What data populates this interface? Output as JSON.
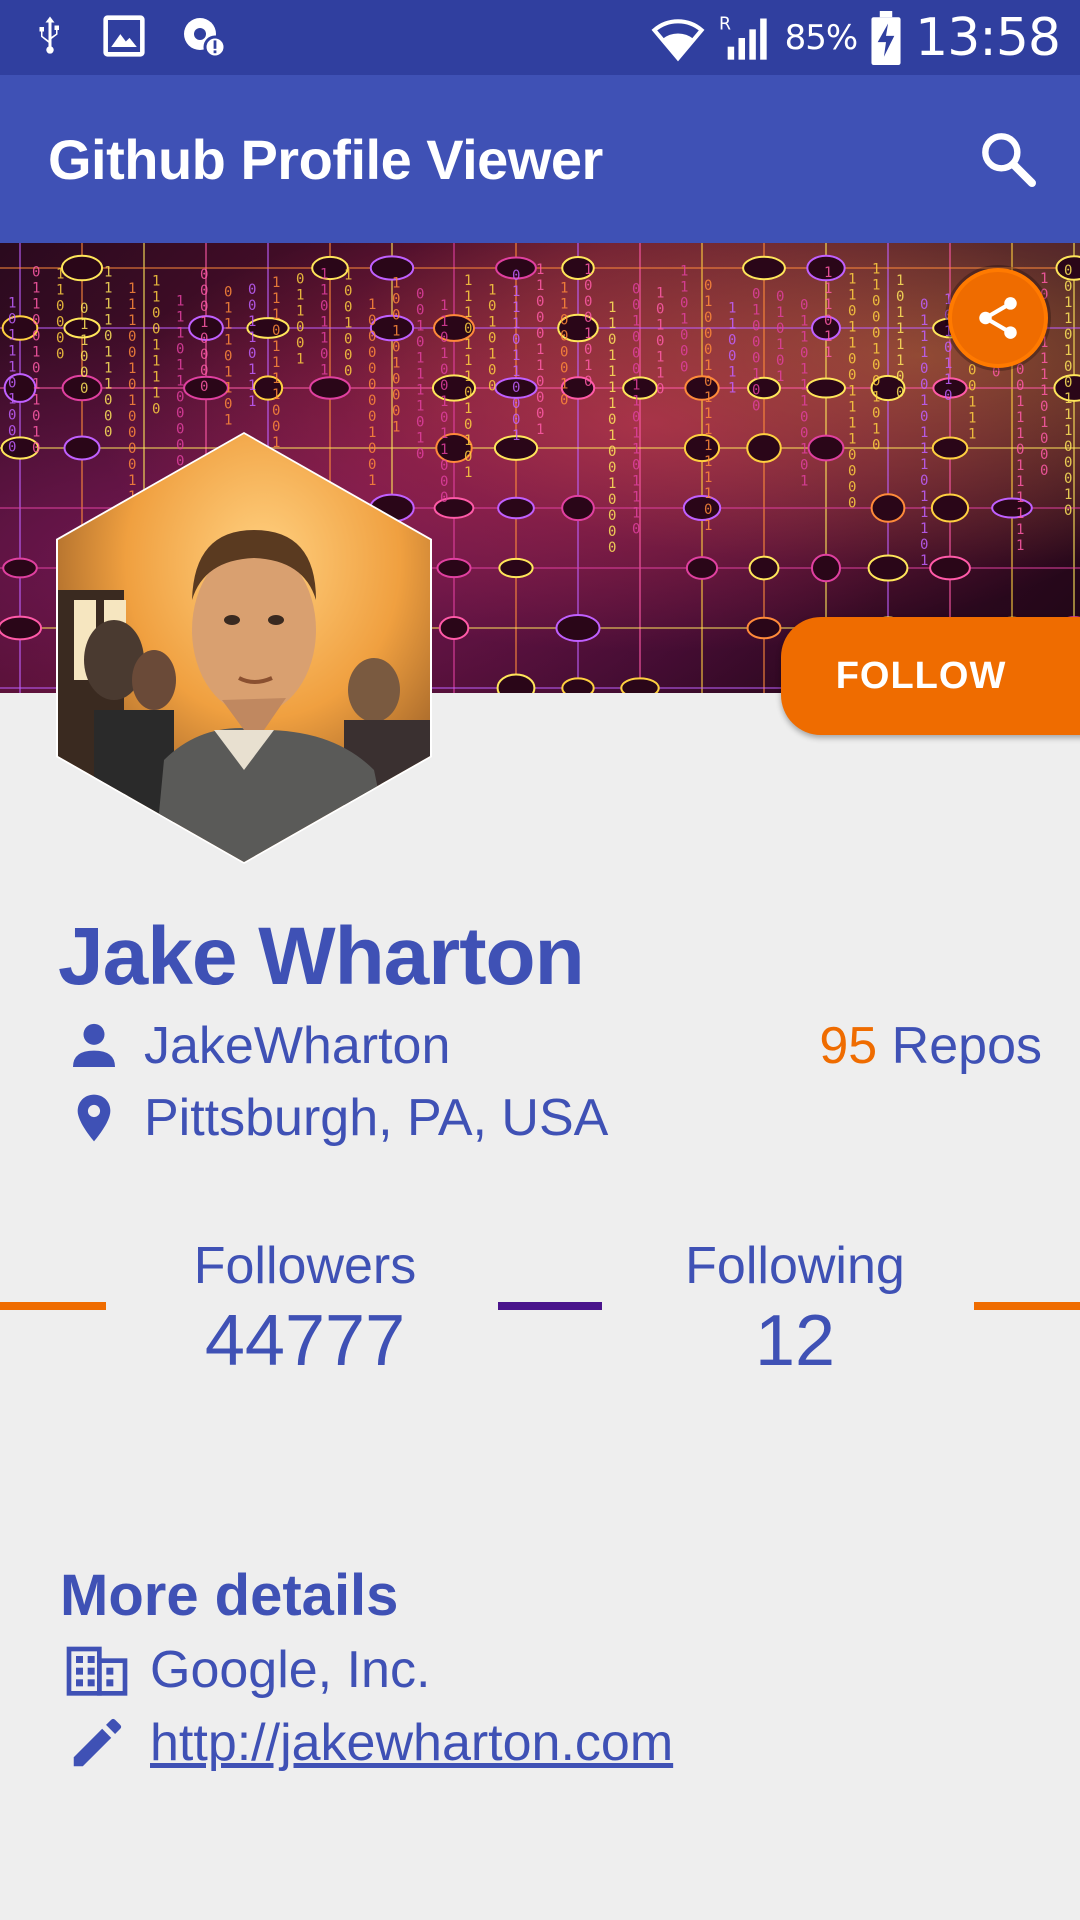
{
  "status_bar": {
    "battery": "85%",
    "time": "13:58",
    "icons": [
      "usb-icon",
      "image-icon",
      "sync-problem-icon",
      "wifi-icon",
      "signal-icon",
      "battery-charging-icon"
    ]
  },
  "app_bar": {
    "title": "Github Profile Viewer",
    "search_icon": "search-icon"
  },
  "header": {
    "share_icon": "share-icon",
    "follow_label": "FOLLOW"
  },
  "profile": {
    "name": "Jake Wharton",
    "username": "JakeWharton",
    "location": "Pittsburgh, PA, USA",
    "repos_count": "95",
    "repos_label": " Repos"
  },
  "stats": {
    "followers_label": "Followers",
    "followers_value": "44777",
    "following_label": "Following",
    "following_value": "12"
  },
  "details": {
    "title": "More details",
    "company": "Google, Inc.",
    "website": "http://jakewharton.com"
  },
  "colors": {
    "primary": "#3f51b5",
    "primary_dark": "#303f9f",
    "accent": "#ef6c00",
    "divider_purple": "#4a148c",
    "background": "#eeeeee"
  }
}
